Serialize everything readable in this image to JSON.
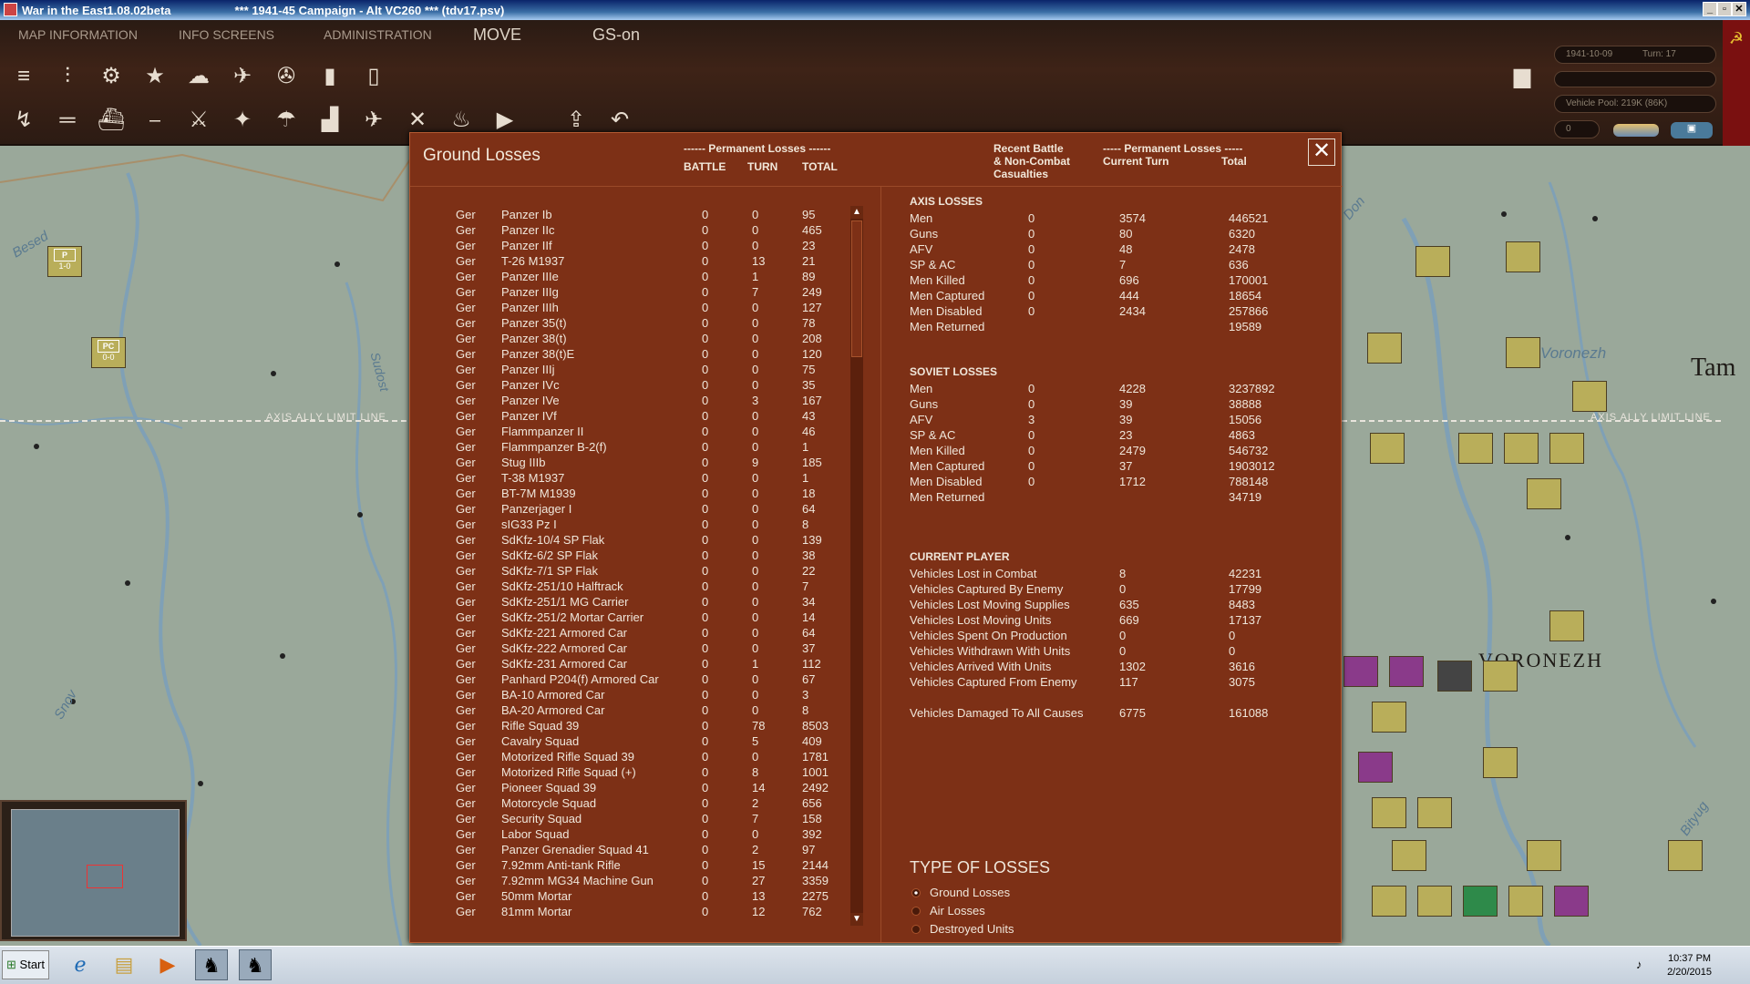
{
  "window": {
    "title": "War in the East1.08.02beta",
    "subtitle": "***  1941-45 Campaign - Alt VC260  ***  (tdv17.psv)"
  },
  "menu": {
    "map_info": "MAP INFORMATION",
    "info_screens": "INFO SCREENS",
    "admin": "ADMINISTRATION",
    "move": "MOVE",
    "gs": "GS-on"
  },
  "status": {
    "date": "1941-10-09",
    "turn": "Turn: 17",
    "vehicle_pool": "Vehicle Pool: 219K (86K)",
    "counter": "0"
  },
  "map_labels": {
    "l1": "Besed",
    "l2": "Sudost",
    "l3": "Snov",
    "l4": "AXIS ALLY LIMIT LINE",
    "l5": "AXIS ALLY LIMIT LINE",
    "l6": "Voronezh",
    "l7": "VORONEZH",
    "l8": "Tam",
    "l9": "Don",
    "l10": "Bityug"
  },
  "units": {
    "u1": {
      "sym": "P",
      "val": "1-0"
    },
    "u2": {
      "sym": "PC",
      "val": "0-0"
    }
  },
  "dialog": {
    "title": "Ground Losses",
    "perm_header": "------ Permanent Losses ------",
    "col_battle": "BATTLE",
    "col_turn": "TURN",
    "col_total": "TOTAL",
    "recent_header_1": "Recent Battle",
    "recent_header_2": "& Non-Combat",
    "recent_header_3": "Casualties",
    "perm_header_right": "----- Permanent Losses -----",
    "col_current": "Current Turn",
    "col_total_right": "Total",
    "rows": [
      [
        "Ger",
        "Panzer Ib",
        "0",
        "0",
        "95"
      ],
      [
        "Ger",
        "Panzer IIc",
        "0",
        "0",
        "465"
      ],
      [
        "Ger",
        "Panzer IIf",
        "0",
        "0",
        "23"
      ],
      [
        "Ger",
        "T-26 M1937",
        "0",
        "13",
        "21"
      ],
      [
        "Ger",
        "Panzer IIIe",
        "0",
        "1",
        "89"
      ],
      [
        "Ger",
        "Panzer IIIg",
        "0",
        "7",
        "249"
      ],
      [
        "Ger",
        "Panzer IIIh",
        "0",
        "0",
        "127"
      ],
      [
        "Ger",
        "Panzer 35(t)",
        "0",
        "0",
        "78"
      ],
      [
        "Ger",
        "Panzer 38(t)",
        "0",
        "0",
        "208"
      ],
      [
        "Ger",
        "Panzer 38(t)E",
        "0",
        "0",
        "120"
      ],
      [
        "Ger",
        "Panzer IIIj",
        "0",
        "0",
        "75"
      ],
      [
        "Ger",
        "Panzer IVc",
        "0",
        "0",
        "35"
      ],
      [
        "Ger",
        "Panzer IVe",
        "0",
        "3",
        "167"
      ],
      [
        "Ger",
        "Panzer IVf",
        "0",
        "0",
        "43"
      ],
      [
        "Ger",
        "Flammpanzer II",
        "0",
        "0",
        "46"
      ],
      [
        "Ger",
        "Flammpanzer B-2(f)",
        "0",
        "0",
        "1"
      ],
      [
        "Ger",
        "Stug IIIb",
        "0",
        "9",
        "185"
      ],
      [
        "Ger",
        "T-38 M1937",
        "0",
        "0",
        "1"
      ],
      [
        "Ger",
        "BT-7M M1939",
        "0",
        "0",
        "18"
      ],
      [
        "Ger",
        "Panzerjager I",
        "0",
        "0",
        "64"
      ],
      [
        "Ger",
        "sIG33 Pz I",
        "0",
        "0",
        "8"
      ],
      [
        "Ger",
        "SdKfz-10/4 SP Flak",
        "0",
        "0",
        "139"
      ],
      [
        "Ger",
        "SdKfz-6/2 SP Flak",
        "0",
        "0",
        "38"
      ],
      [
        "Ger",
        "SdKfz-7/1 SP Flak",
        "0",
        "0",
        "22"
      ],
      [
        "Ger",
        "SdKfz-251/10 Halftrack",
        "0",
        "0",
        "7"
      ],
      [
        "Ger",
        "SdKfz-251/1 MG Carrier",
        "0",
        "0",
        "34"
      ],
      [
        "Ger",
        "SdKfz-251/2 Mortar Carrier",
        "0",
        "0",
        "14"
      ],
      [
        "Ger",
        "SdKfz-221 Armored Car",
        "0",
        "0",
        "64"
      ],
      [
        "Ger",
        "SdKfz-222 Armored Car",
        "0",
        "0",
        "37"
      ],
      [
        "Ger",
        "SdKfz-231 Armored Car",
        "0",
        "1",
        "112"
      ],
      [
        "Ger",
        "Panhard P204(f) Armored Car",
        "0",
        "0",
        "67"
      ],
      [
        "Ger",
        "BA-10 Armored Car",
        "0",
        "0",
        "3"
      ],
      [
        "Ger",
        "BA-20 Armored Car",
        "0",
        "0",
        "8"
      ],
      [
        "Ger",
        "Rifle Squad 39",
        "0",
        "78",
        "8503"
      ],
      [
        "Ger",
        "Cavalry Squad",
        "0",
        "5",
        "409"
      ],
      [
        "Ger",
        "Motorized Rifle Squad 39",
        "0",
        "0",
        "1781"
      ],
      [
        "Ger",
        "Motorized Rifle Squad (+)",
        "0",
        "8",
        "1001"
      ],
      [
        "Ger",
        "Pioneer Squad 39",
        "0",
        "14",
        "2492"
      ],
      [
        "Ger",
        "Motorcycle Squad",
        "0",
        "2",
        "656"
      ],
      [
        "Ger",
        "Security Squad",
        "0",
        "7",
        "158"
      ],
      [
        "Ger",
        "Labor Squad",
        "0",
        "0",
        "392"
      ],
      [
        "Ger",
        "Panzer Grenadier Squad 41",
        "0",
        "2",
        "97"
      ],
      [
        "Ger",
        "7.92mm Anti-tank Rifle",
        "0",
        "15",
        "2144"
      ],
      [
        "Ger",
        "7.92mm MG34 Machine Gun",
        "0",
        "27",
        "3359"
      ],
      [
        "Ger",
        "50mm Mortar",
        "0",
        "13",
        "2275"
      ],
      [
        "Ger",
        "81mm Mortar",
        "0",
        "12",
        "762"
      ]
    ],
    "axis_title": "AXIS LOSSES",
    "axis": [
      [
        "Men",
        "0",
        "3574",
        "446521"
      ],
      [
        "Guns",
        "0",
        "80",
        "6320"
      ],
      [
        "AFV",
        "0",
        "48",
        "2478"
      ],
      [
        "SP & AC",
        "0",
        "7",
        "636"
      ]
    ],
    "axis2": [
      [
        "Men Killed",
        "0",
        "696",
        "170001"
      ],
      [
        "Men Captured",
        "0",
        "444",
        "18654"
      ],
      [
        "Men Disabled",
        "0",
        "2434",
        "257866"
      ],
      [
        "Men Returned",
        "",
        "",
        "19589"
      ]
    ],
    "soviet_title": "SOVIET LOSSES",
    "soviet": [
      [
        "Men",
        "0",
        "4228",
        "3237892"
      ],
      [
        "Guns",
        "0",
        "39",
        "38888"
      ],
      [
        "AFV",
        "3",
        "39",
        "15056"
      ],
      [
        "SP & AC",
        "0",
        "23",
        "4863"
      ]
    ],
    "soviet2": [
      [
        "Men Killed",
        "0",
        "2479",
        "546732"
      ],
      [
        "Men Captured",
        "0",
        "37",
        "1903012"
      ],
      [
        "Men Disabled",
        "0",
        "1712",
        "788148"
      ],
      [
        "Men Returned",
        "",
        "",
        "34719"
      ]
    ],
    "player_title": "CURRENT PLAYER",
    "player": [
      [
        "Vehicles Lost in Combat",
        "8",
        "42231"
      ],
      [
        "Vehicles Captured By Enemy",
        "0",
        "17799"
      ],
      [
        "Vehicles Lost Moving Supplies",
        "635",
        "8483"
      ],
      [
        "Vehicles Lost Moving Units",
        "669",
        "17137"
      ],
      [
        "Vehicles Spent On Production",
        "0",
        "0"
      ],
      [
        "Vehicles Withdrawn With Units",
        "0",
        "0"
      ],
      [
        "Vehicles Arrived With Units",
        "1302",
        "3616"
      ],
      [
        "Vehicles Captured From Enemy",
        "117",
        "3075"
      ]
    ],
    "damaged": [
      "Vehicles Damaged To All Causes",
      "6775",
      "161088"
    ],
    "type_title": "TYPE OF LOSSES",
    "types": [
      "Ground Losses",
      "Air Losses",
      "Destroyed Units"
    ]
  },
  "taskbar": {
    "start": "Start",
    "time": "10:37 PM",
    "date": "2/20/2015"
  }
}
